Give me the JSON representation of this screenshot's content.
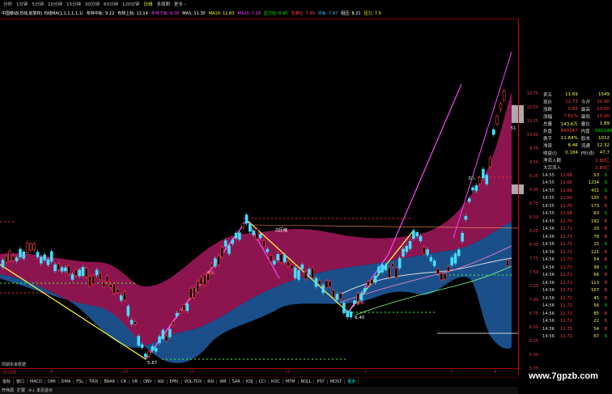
{
  "top_tabs": [
    "分时",
    "1分钟",
    "5分钟",
    "10分钟",
    "15分钟",
    "30分钟",
    "60分钟",
    "120分钟",
    "日线",
    "多周期",
    "更多 ›"
  ],
  "selected_top_tab": "日线",
  "info_bar": [
    {
      "text": "中国移动(日线,前复权) 均线MA(1,1,1,1,1,1)",
      "color": "#ffffff"
    },
    {
      "text": "布林中轨: 9.22",
      "color": "#ffffff"
    },
    {
      "text": "布林上轨: 12.14",
      "color": "#ffffff"
    },
    {
      "text": "布林下轨: 6.30",
      "color": "#ff40ff"
    },
    {
      "text": "MA5: 11.30",
      "color": "#ffffff"
    },
    {
      "text": "MA10: 11.83",
      "color": "#ffff00"
    },
    {
      "text": "MA20: 7.28",
      "color": "#ff40ff"
    },
    {
      "text": "压力位: 6.95",
      "color": "#00ff00"
    },
    {
      "text": "支撑位: 7.99",
      "color": "#ff4040"
    },
    {
      "text": "中轨: 7.97",
      "color": "#40c0ff"
    },
    {
      "text": "阻压: 8.21",
      "color": "#ffffff"
    },
    {
      "text": "压力: 7.9",
      "color": "#ffff00"
    }
  ],
  "price_axis": [
    "10.75",
    "10.50",
    "10.25",
    "10.00",
    "9.75",
    "9.50",
    "9.25",
    "9.00",
    "8.75",
    "8.50",
    "8.25",
    "8.00",
    "7.75",
    "7.50",
    "7.25",
    "7.00",
    "6.75",
    "6.50",
    "6.25",
    "6.00",
    "5.75"
  ],
  "chart_labels": {
    "label_left": "5.67",
    "label_mid": "6.40",
    "label_end": "51",
    "note": "周期未来数据",
    "sig1": "买入",
    "sig2": "ZJ压缩",
    "sig3": "卖出",
    "sig4": "卖出"
  },
  "quote_panel": [
    {
      "l": "卖五",
      "v": "11.69",
      "v_color": "#ffff40",
      "r": "",
      "rv": "1549",
      "rv_color": "#ffff40"
    },
    {
      "l": "现价",
      "v": "11.73",
      "v_color": "#ff4040",
      "r": "今开",
      "rv": "10.90",
      "rv_color": "#ff4040"
    },
    {
      "l": "涨跌",
      "v": "0.83",
      "v_color": "#ff4040",
      "r": "最高",
      "rv": "10.90",
      "rv_color": "#ff4040"
    },
    {
      "l": "涨幅",
      "v": "7.61%",
      "v_color": "#ff4040",
      "r": "最低",
      "rv": "10.90",
      "rv_color": "#ff4040"
    },
    {
      "l": "总量",
      "v": "143.6万",
      "v_color": "#ffff40",
      "r": "量比",
      "rv": "1.89",
      "rv_color": "#ffff40"
    },
    {
      "l": "外盘",
      "v": "849347",
      "v_color": "#ff4040",
      "r": "内盘",
      "rv": "591149",
      "rv_color": "#00ff00"
    },
    {
      "l": "换手",
      "v": "11.64%",
      "v_color": "#ffff40",
      "r": "股本",
      "rv": "1012",
      "rv_color": "#ffff40"
    },
    {
      "l": "净资",
      "v": "6.46",
      "v_color": "#ffff40",
      "r": "流通",
      "rv": "12.32",
      "rv_color": "#ffff40"
    },
    {
      "l": "收益(I)",
      "v": "0.184",
      "v_color": "#ffff40",
      "r": "PE(动)",
      "rv": "47.7",
      "rv_color": "#ffff40"
    },
    {
      "l": "净流入额",
      "v": "",
      "v_color": "#ff4040",
      "r": "",
      "rv": "2.80亿",
      "rv_color": "#ff4040"
    },
    {
      "l": "大宗流入",
      "v": "",
      "v_color": "#ff4040",
      "r": "",
      "rv": "1.80亿",
      "rv_color": "#ff4040"
    }
  ],
  "ticks": [
    {
      "t": "14:55",
      "p": "11.68",
      "v": "53",
      "c": "#00ff00"
    },
    {
      "t": "14:55",
      "p": "11.66",
      "v": "1234",
      "c": "#00ff00"
    },
    {
      "t": "14:55",
      "p": "11.66",
      "v": "431",
      "c": "#00ff00"
    },
    {
      "t": "14:55",
      "p": "11.69",
      "v": "135",
      "c": "#ff4040"
    },
    {
      "t": "14:55",
      "p": "11.70",
      "v": "173",
      "c": "#ff4040"
    },
    {
      "t": "14:55",
      "p": "11.68",
      "v": "63",
      "c": "#00ff00"
    },
    {
      "t": "14:55",
      "p": "11.70",
      "v": "192",
      "c": "#ff4040"
    },
    {
      "t": "14:56",
      "p": "11.71",
      "v": "20",
      "c": "#ff4040"
    },
    {
      "t": "14:56",
      "p": "11.73",
      "v": "78",
      "c": "#ff4040"
    },
    {
      "t": "14:56",
      "p": "11.71",
      "v": "15",
      "c": "#00ff00"
    },
    {
      "t": "14:56",
      "p": "11.72",
      "v": "121",
      "c": "#ff4040"
    },
    {
      "t": "14:56",
      "p": "11.72",
      "v": "54",
      "c": "#ff4040"
    },
    {
      "t": "14:56",
      "p": "11.72",
      "v": "98",
      "c": "#00ff00"
    },
    {
      "t": "14:56",
      "p": "11.72",
      "v": "66",
      "c": "#ff4040"
    },
    {
      "t": "14:56",
      "p": "11.72",
      "v": "113",
      "c": "#ff4040"
    },
    {
      "t": "14:56",
      "p": "11.72",
      "v": "107",
      "c": "#ff4040"
    },
    {
      "t": "14:56",
      "p": "11.72",
      "v": "45",
      "c": "#ff4040"
    },
    {
      "t": "14:56",
      "p": "11.72",
      "v": "56",
      "c": "#00ff00"
    },
    {
      "t": "14:56",
      "p": "11.72",
      "v": "85",
      "c": "#ff4040"
    },
    {
      "t": "14:56",
      "p": "11.72",
      "v": "22",
      "c": "#ff4040"
    },
    {
      "t": "14:56",
      "p": "11.73",
      "v": "54",
      "c": "#ff4040"
    },
    {
      "t": "14:56",
      "p": "11.72",
      "v": "67",
      "c": "#00ff00"
    }
  ],
  "date_axis": [
    "2018年",
    "8",
    "10",
    "11",
    "12",
    "2",
    "3",
    "4"
  ],
  "indicator_tabs": [
    "指标",
    "窗口",
    "MACD",
    "DMI",
    "DMA",
    "FSL",
    "TRIX",
    "BRAR",
    "CR",
    "VR",
    "OBV",
    "ASI",
    "EMV",
    "VOL-TDX",
    "RSI",
    "WR",
    "SAR",
    "KDJ",
    "CCI",
    "ROC",
    "MTM",
    "BOLL",
    "PSY",
    "MOST",
    "更多"
  ],
  "selected_indicator": "更多",
  "bottom_tabs": [
    "开伟源",
    "扩展",
    "≡↓ 本页显示"
  ],
  "watermark": "www.7gpzb.com"
}
